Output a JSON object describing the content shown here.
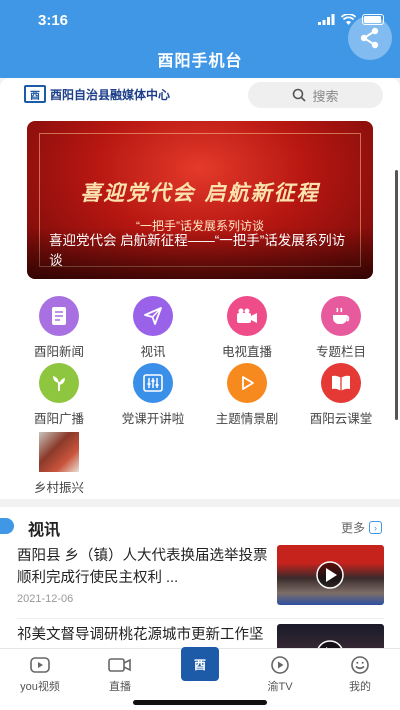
{
  "status_bar": {
    "time": "3:16"
  },
  "app": {
    "title": "酉阳手机台"
  },
  "brand": {
    "logo_text": "酉",
    "name": "酉阳自治县融媒体中心"
  },
  "search": {
    "label": "搜索"
  },
  "banner": {
    "headline": "喜迎党代会 启航新征程",
    "subline": "“一把手”话发展系列访谈",
    "caption": "喜迎党代会 启航新征程——“一把手”话发展系列访谈"
  },
  "grid": [
    {
      "label": "酉阳新闻",
      "icon": "news-icon",
      "color": "#a870e0"
    },
    {
      "label": "视讯",
      "icon": "send-icon",
      "color": "#9a62e8"
    },
    {
      "label": "电视直播",
      "icon": "video-camera-icon",
      "color": "#ee4d8a"
    },
    {
      "label": "专题栏目",
      "icon": "coffee-icon",
      "color": "#e75a9e"
    },
    {
      "label": "酉阳广播",
      "icon": "radio-icon",
      "color": "#8ec63f"
    },
    {
      "label": "党课开讲啦",
      "icon": "equalizer-icon",
      "color": "#3a8fe8"
    },
    {
      "label": "主题情景剧",
      "icon": "play-icon",
      "color": "#f68a1f"
    },
    {
      "label": "酉阳云课堂",
      "icon": "book-icon",
      "color": "#e53935"
    },
    {
      "label": "乡村振兴",
      "icon": "rural-thumbnail-icon",
      "color": ""
    }
  ],
  "section": {
    "title": "视讯",
    "more_label": "更多"
  },
  "news": [
    {
      "title": "酉阳县 乡（镇）人大代表换届选举投票顺利完成行使民主权利 ...",
      "date": "2021-12-06"
    },
    {
      "title": "祁美文督导调研桃花源城市更新工作坚定信心不动摇 瞄准目标 ...",
      "date": ""
    }
  ],
  "tabbar": [
    {
      "label": "you视频",
      "icon": "youtube-icon"
    },
    {
      "label": "直播",
      "icon": "camera-icon"
    },
    {
      "label": "",
      "icon": "home-logo-icon"
    },
    {
      "label": "渝TV",
      "icon": "tv-play-icon"
    },
    {
      "label": "我的",
      "icon": "profile-icon"
    }
  ],
  "colors": {
    "primary": "#3f97e6",
    "brand_blue": "#1d5aa8"
  }
}
